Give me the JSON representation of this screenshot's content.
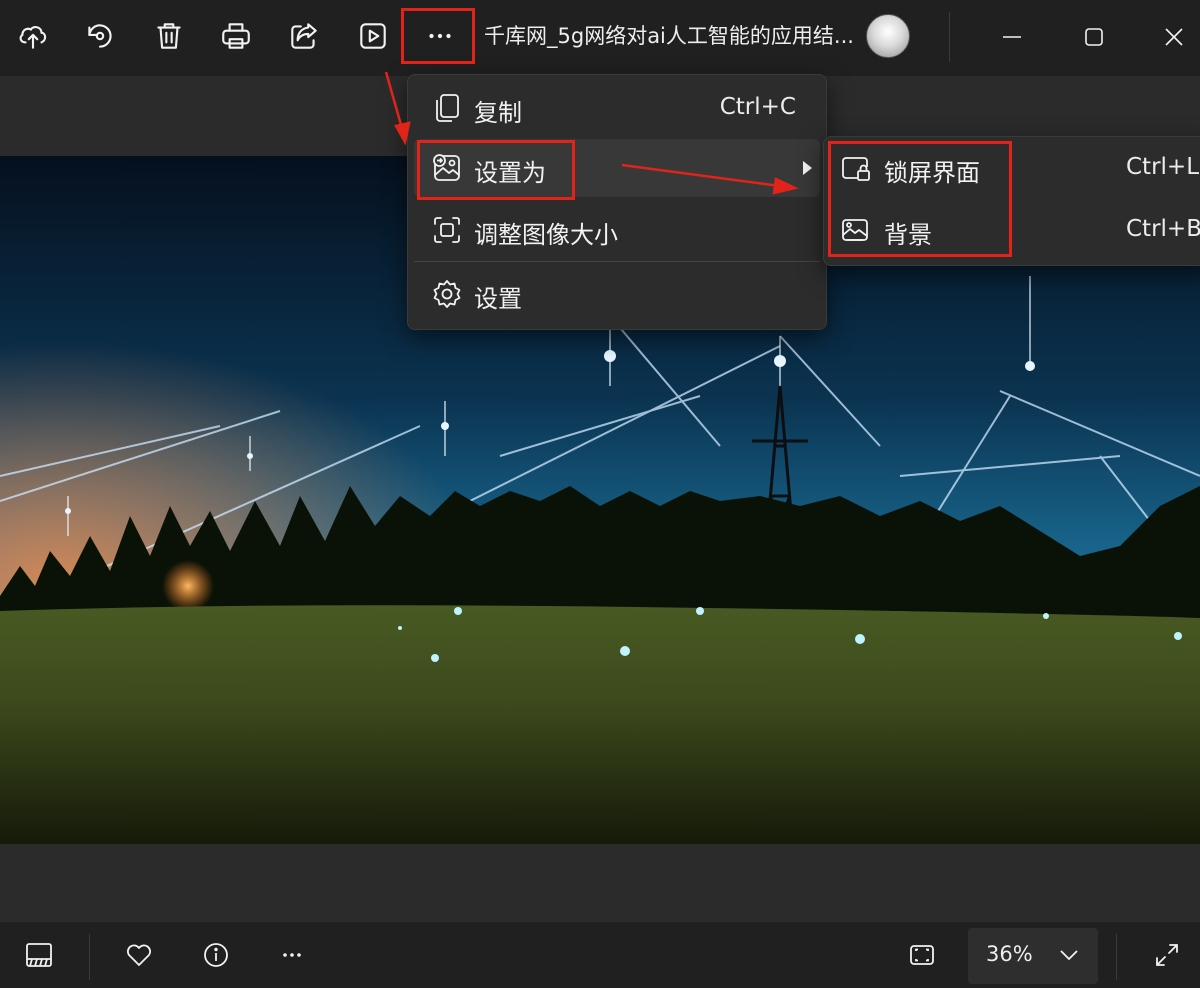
{
  "toolbar": {
    "title": "千库网_5g网络对ai人工智能的应用结...",
    "buttons": [
      {
        "name": "upload-icon"
      },
      {
        "name": "rotate-icon"
      },
      {
        "name": "delete-icon"
      },
      {
        "name": "print-icon"
      },
      {
        "name": "share-icon"
      },
      {
        "name": "slideshow-icon"
      },
      {
        "name": "more-icon"
      }
    ]
  },
  "window_controls": [
    "minimize",
    "maximize",
    "close"
  ],
  "menu": {
    "items": [
      {
        "label": "复制",
        "shortcut": "Ctrl+C",
        "icon": "copy-icon"
      },
      {
        "label": "设置为",
        "shortcut": "",
        "icon": "set-as-icon",
        "has_submenu": true,
        "active": true
      },
      {
        "label": "调整图像大小",
        "shortcut": "",
        "icon": "resize-icon"
      },
      {
        "label": "设置",
        "shortcut": "",
        "icon": "settings-icon"
      }
    ]
  },
  "submenu": {
    "items": [
      {
        "label": "锁屏界面",
        "shortcut": "Ctrl+L",
        "icon": "lock-screen-icon"
      },
      {
        "label": "背景",
        "shortcut": "Ctrl+B",
        "icon": "background-icon"
      }
    ]
  },
  "bottombar": {
    "zoom": "36%",
    "buttons": [
      "filmstrip-icon",
      "favorite-icon",
      "info-icon",
      "more-icon",
      "fit-window-icon",
      "fullscreen-icon"
    ]
  },
  "colors": {
    "annotation": "#e2231a",
    "toolbar_bg": "#202020",
    "menu_bg": "#2c2c2c",
    "active_item": "#383838"
  }
}
